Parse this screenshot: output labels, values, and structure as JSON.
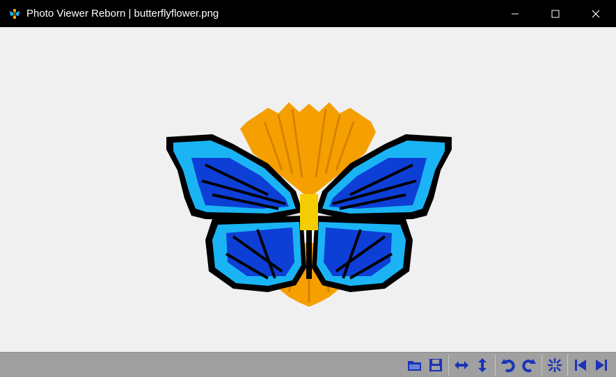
{
  "window": {
    "title": "Photo Viewer Reborn | butterflyflower.png",
    "app_icon": "butterfly-app-icon",
    "controls": [
      "minimize-icon",
      "maximize-icon",
      "close-icon"
    ]
  },
  "viewer": {
    "image_subject": "pixel-art blue butterfly on orange flower",
    "background_color": "#f0f0f0"
  },
  "toolbar": {
    "background_color": "#a0a0a0",
    "icon_color": "#1a33b8",
    "groups": [
      [
        "open-folder-icon",
        "save-icon"
      ],
      [
        "flip-horizontal-icon",
        "flip-vertical-icon"
      ],
      [
        "rotate-left-icon",
        "rotate-right-icon"
      ],
      [
        "fit-expand-icon"
      ],
      [
        "previous-image-icon",
        "next-image-icon"
      ]
    ]
  },
  "colors": {
    "titlebar": "#000000",
    "butterfly_dark": "#0d3fd6",
    "butterfly_light": "#1ab4f5",
    "flower": "#f5a000",
    "flower_center": "#f5cc00"
  }
}
